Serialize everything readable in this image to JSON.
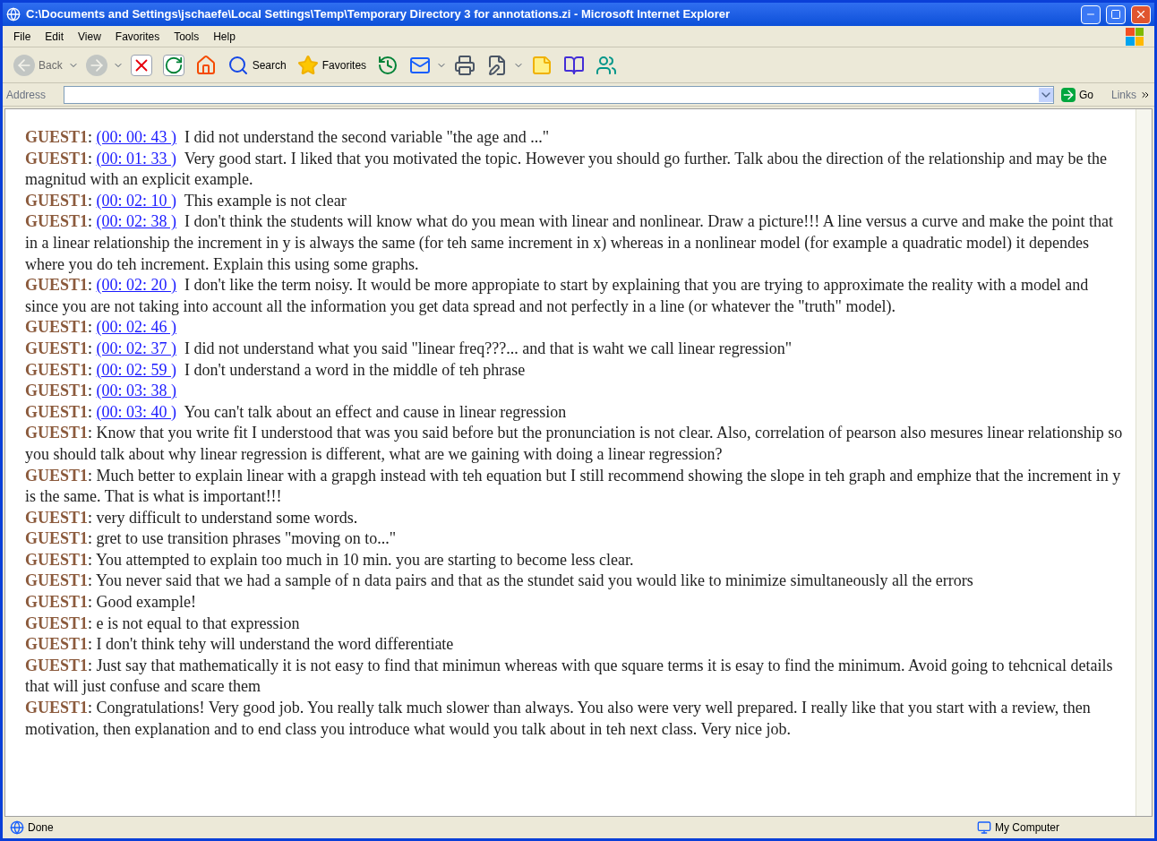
{
  "window": {
    "title": "C:\\Documents and Settings\\jschaefe\\Local Settings\\Temp\\Temporary Directory 3 for annotations.zi - Microsoft Internet Explorer"
  },
  "menu": [
    "File",
    "Edit",
    "View",
    "Favorites",
    "Tools",
    "Help"
  ],
  "toolbar": [
    {
      "kind": "back",
      "label": "Back",
      "disabled": true
    },
    {
      "kind": "forward",
      "disabled": true
    },
    {
      "kind": "stop"
    },
    {
      "kind": "refresh"
    },
    {
      "kind": "home"
    },
    {
      "kind": "search",
      "label": "Search"
    },
    {
      "kind": "favorites",
      "label": "Favorites"
    },
    {
      "kind": "history"
    },
    {
      "kind": "mail"
    },
    {
      "kind": "print"
    },
    {
      "kind": "edit"
    },
    {
      "kind": "notes"
    },
    {
      "kind": "research"
    },
    {
      "kind": "messenger"
    }
  ],
  "address_bar": {
    "label": "Address",
    "go": "Go",
    "links": "Links"
  },
  "comments": [
    {
      "author": "GUEST1",
      "sep": ":",
      "time": "(00: 00: 43 )",
      "text": "I did not understand the second variable \"the age and ...\""
    },
    {
      "author": "GUEST1",
      "sep": ":",
      "time": "(00: 01: 33 )",
      "text": "Very good start. I liked that you motivated the topic. However you should go further. Talk abou the direction of the relationship and may be the magnitud with an explicit example."
    },
    {
      "author": "GUEST1",
      "sep": ":",
      "time": "(00: 02: 10 )",
      "text": "This example is not clear"
    },
    {
      "author": "GUEST1",
      "sep": ":",
      "time": "(00: 02: 38 )",
      "text": "I don't think the students will know what do you mean with linear and nonlinear. Draw a picture!!! A line versus a curve and make the point that in a linear relationship the increment in y is always the same (for teh same increment in x) whereas in a nonlinear model (for example a quadratic model) it dependes where you do teh increment. Explain this using some graphs."
    },
    {
      "author": "GUEST1",
      "sep": ":",
      "time": "(00: 02: 20 )",
      "text": "I don't like the term noisy. It would be more appropiate to start by explaining that you are trying to approximate the reality with a model and since you are not taking into account all the information you get data spread and not perfectly in a line (or whatever the \"truth\" model)."
    },
    {
      "author": "GUEST1",
      "sep": ":",
      "time": "(00: 02: 46 )"
    },
    {
      "author": "GUEST1",
      "sep": ":",
      "time": "(00: 02: 37 )",
      "text": "I did not understand what you said \"linear freq???... and that is waht we call linear regression\""
    },
    {
      "author": "GUEST1",
      "sep": ":",
      "time": "(00: 02: 59 )",
      "text": "I don't understand a word in the middle of teh phrase"
    },
    {
      "author": "GUEST1",
      "sep": ":",
      "time": "(00: 03: 38 )"
    },
    {
      "author": "GUEST1",
      "sep": ":",
      "time": "(00: 03: 40 )",
      "text": "You can't talk about an effect and cause in linear regression"
    },
    {
      "author": "GUEST1",
      "sep": ":",
      "text": "Know that you write fit I understood that was you said before but the pronunciation is not clear. Also, correlation of pearson also mesures linear relationship so you should talk about why linear regression is different, what are we gaining with doing a linear regression?"
    },
    {
      "author": "GUEST1",
      "sep": ":",
      "text": "Much better to explain linear with a grapgh instead with teh equation but I still recommend showing the slope in teh graph and emphize that the increment in y is the same. That is what is important!!!"
    },
    {
      "author": "GUEST1",
      "sep": ":",
      "text": "very difficult to understand some words."
    },
    {
      "author": "GUEST1",
      "sep": ":",
      "text": "gret to use transition phrases \"moving on to...\""
    },
    {
      "author": "GUEST1",
      "sep": ":",
      "text": "You attempted to explain too much in 10 min. you are starting to become less clear."
    },
    {
      "author": "GUEST1",
      "sep": ":",
      "text": "You never said that we had a sample of n data pairs and that as the stundet said you would like to minimize simultaneously all the errors"
    },
    {
      "author": "GUEST1",
      "sep": ":",
      "text": "Good example!"
    },
    {
      "author": "GUEST1",
      "sep": ":",
      "text": "e is not equal to that expression"
    },
    {
      "author": "GUEST1",
      "sep": ":",
      "text": "I don't think tehy will understand the word differentiate"
    },
    {
      "author": "GUEST1",
      "sep": ":",
      "text": "Just say that mathematically it is not easy to find that minimun whereas with que square terms it is esay to find the minimum. Avoid going to tehcnical details that will just confuse and scare them"
    },
    {
      "author": "GUEST1",
      "sep": ":",
      "text": "Congratulations! Very good job. You really talk much slower than always. You also were very well prepared. I really like that you start with a review, then motivation, then explanation and to end class you introduce what would you talk about in teh next class. Very nice job."
    }
  ],
  "status_bar": {
    "text": "Done",
    "zone": "My Computer"
  }
}
